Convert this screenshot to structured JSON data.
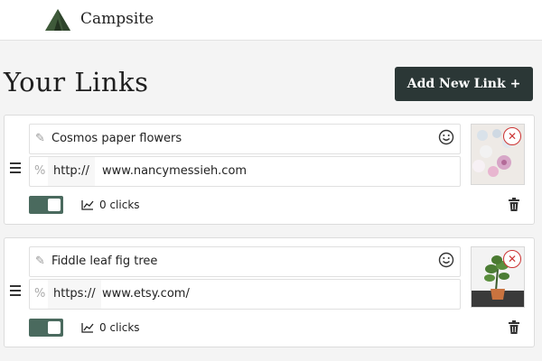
{
  "header": {
    "brand": "Campsite",
    "logo_icon": "tent-icon"
  },
  "page": {
    "title": "Your Links",
    "add_button_label": "Add New Link +"
  },
  "links": [
    {
      "title": "Cosmos paper flowers",
      "protocol": "http://",
      "url": "www.nancymessieh.com",
      "clicks_label": "0 clicks",
      "enabled": true
    },
    {
      "title": "Fiddle leaf fig tree",
      "protocol": "https://",
      "url": "www.etsy.com/",
      "clicks_label": "0 clicks",
      "enabled": true
    }
  ],
  "colors": {
    "primary_button": "#2b3736",
    "toggle_on": "#4a6a5e",
    "remove": "#cc3333"
  }
}
